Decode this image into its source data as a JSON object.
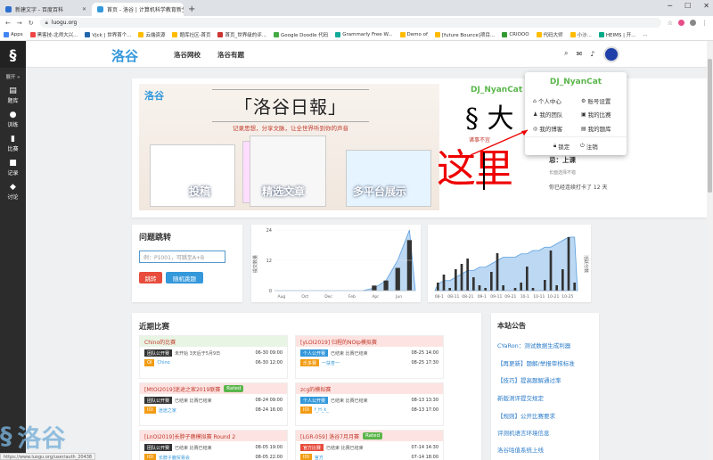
{
  "browser": {
    "tabs": [
      {
        "title": "新建文字 - 百度百科",
        "active": false
      },
      {
        "title": "首页 - 洛谷 | 计算机科学教育新生态",
        "active": true
      }
    ],
    "url": "luogu.org",
    "bookmarks": [
      "Apps",
      "黑客技-北师大兴...",
      "Vjck | 世界首个...",
      "云端资源",
      "题库社区-首页",
      "首页_世界级的评...",
      "Google Doodle 代码",
      "Grammarly Free W...",
      "Demo of",
      "[future Bounce]项目...",
      "CRIOOO",
      "代码大师",
      "小沙...",
      "HEIMS | 开...",
      "..."
    ],
    "status_url": "https://www.luogu.org/user/auth_20438"
  },
  "sidebar": {
    "logo": "§",
    "expand": "展开 »",
    "items": [
      {
        "label": "题库",
        "icon": "book-icon"
      },
      {
        "label": "训练",
        "icon": "lightbulb-icon"
      },
      {
        "label": "比赛",
        "icon": "bar-chart-icon"
      },
      {
        "label": "记录",
        "icon": "record-icon"
      },
      {
        "label": "讨论",
        "icon": "chat-icon"
      }
    ]
  },
  "nav": {
    "brand": "洛谷",
    "links": [
      "洛谷网校",
      "洛谷有题"
    ]
  },
  "banner": {
    "logo": "洛谷",
    "title": "「洛谷日報」",
    "subtitle": "记录思想，分享文脉，让全世界听到你的声音",
    "captions": [
      "投稿",
      "精选文章",
      "多平台展示"
    ]
  },
  "user_panel": {
    "username": "DJ_NyanCat",
    "rank_char": "§ 大",
    "motto": "诸事不宜",
    "overlay_text": "这里",
    "checkin_label": "忌：上课",
    "checkin_sub": "长面选择不错",
    "streak": "你已经连续打卡了 12 天"
  },
  "user_menu": {
    "username": "DJ_NyanCat",
    "items": [
      {
        "label": "个人中心",
        "icon": "home-icon"
      },
      {
        "label": "账号设置",
        "icon": "user-settings-icon"
      },
      {
        "label": "我的团队",
        "icon": "team-icon"
      },
      {
        "label": "我的比赛",
        "icon": "contest-icon"
      },
      {
        "label": "我的博客",
        "icon": "rss-icon"
      },
      {
        "label": "我的题库",
        "icon": "library-icon"
      }
    ],
    "lock": "锁定",
    "logout": "注销"
  },
  "jump": {
    "title": "问题跳转",
    "placeholder": "例：P1001，可跳至A+B",
    "go_label": "跳转",
    "random_label": "随机跳题"
  },
  "chart_data": [
    {
      "type": "area",
      "ylabel": "提交数量",
      "y_ticks": [
        "0",
        "12",
        "24"
      ],
      "x_ticks": [
        "Aug",
        "Oct",
        "Dec",
        "Feb",
        "Apr",
        "Jun"
      ],
      "x": [
        "Aug",
        "Sep",
        "Oct",
        "Nov",
        "Dec",
        "Jan",
        "Feb",
        "Mar",
        "Apr",
        "May",
        "Jun",
        "Jul"
      ],
      "series": [
        {
          "type": "bar",
          "values": [
            0,
            0,
            0,
            0,
            0,
            0,
            0,
            0,
            2,
            4,
            9,
            20
          ]
        },
        {
          "type": "area",
          "values": [
            0,
            0,
            0,
            0,
            0,
            0,
            0,
            0,
            1,
            4,
            12,
            24
          ]
        }
      ],
      "ylim": [
        0,
        24
      ]
    },
    {
      "type": "bar",
      "ylabel_right": "活跃分数",
      "x_ticks": [
        "08-1",
        "08-11",
        "08-21",
        "09-1",
        "09-11",
        "09-21",
        "10-1",
        "10-11",
        "10-21",
        "10-25"
      ],
      "series": [
        {
          "type": "bar",
          "values": [
            3,
            6,
            1,
            8,
            10,
            12,
            5,
            2,
            1,
            7,
            14,
            2,
            0,
            1,
            3,
            9,
            1,
            0,
            4,
            15,
            2,
            8,
            20,
            3
          ]
        },
        {
          "type": "area",
          "values": [
            2,
            3,
            3,
            4,
            5,
            6,
            6,
            7,
            7,
            8,
            9,
            10,
            10,
            10,
            11,
            11,
            12,
            12,
            13,
            13,
            14,
            15,
            16,
            16
          ]
        }
      ]
    }
  ],
  "contests": {
    "title": "近期比赛",
    "items": [
      {
        "name": "Chino的比赛",
        "rated": false,
        "tags": [
          "团队公开赛",
          "OI"
        ],
        "organizer": "Chino",
        "status": "未开始 3天后于5月9日",
        "time_start": "06-30 09:00",
        "time_end": "06-30 12:00",
        "color": "#e9f5e4"
      },
      {
        "name": "[yLOI2019] 归程的NOIp模拟赛",
        "rated": false,
        "tags": [
          "个人公开赛",
          "乐多赛"
        ],
        "organizer": "一扶杏一",
        "status": "已结束 比赛已结束",
        "time_start": "08-25 14:00",
        "time_end": "08-25 17:30",
        "color": "#fde4e2"
      },
      {
        "name": "[MtOI2019]迷途之家2019联赛",
        "rated": true,
        "tags": [
          "团队公开赛",
          "IOI"
        ],
        "organizer": "迷途之家",
        "status": "已结束 比赛已结束",
        "time_start": "08-24 09:00",
        "time_end": "08-24 16:00",
        "color": "#fde4e2"
      },
      {
        "name": "zcg的模拟赛",
        "rated": false,
        "tags": [
          "个人公开赛",
          "IOI"
        ],
        "organizer": "f_H_k_",
        "status": "已结束 比赛已结束",
        "time_start": "08-13 13:30",
        "time_end": "08-13 17:00",
        "color": "#fde4e2"
      },
      {
        "name": "[LnOI2019]长脖子鹿模拟赛 Round 2",
        "rated": false,
        "tags": [
          "团队公开赛",
          "IOI"
        ],
        "organizer": "长脖子鹿贸易会",
        "status": "已结束 比赛已结束",
        "time_start": "08-05 19:00",
        "time_end": "08-05 22:00",
        "color": "#fde4e2"
      },
      {
        "name": "[LGR-059] 洛谷7月月赛",
        "rated": true,
        "tags": [
          "官方比赛",
          "IOI"
        ],
        "organizer": "官方",
        "status": "已结束 比赛已结束",
        "time_start": "07-14 14:30",
        "time_end": "07-14 18:00",
        "color": "#fde4e2"
      }
    ]
  },
  "notices": {
    "title": "本站公告",
    "items": [
      "CYaRon：测试数据生成利器",
      "【再更新】题解/举报审核标准",
      "【技巧】提高题解通过率",
      "新版测评提交规定",
      "【规则】公开比赛要求",
      "评测机语言环境信息",
      "洛谷咕值系统上线"
    ]
  },
  "watermark": "洛谷",
  "colors": {
    "brand": "#3498db",
    "user": "#5ab64b",
    "red": "#e74c3c",
    "blue_btn": "#3498db"
  }
}
